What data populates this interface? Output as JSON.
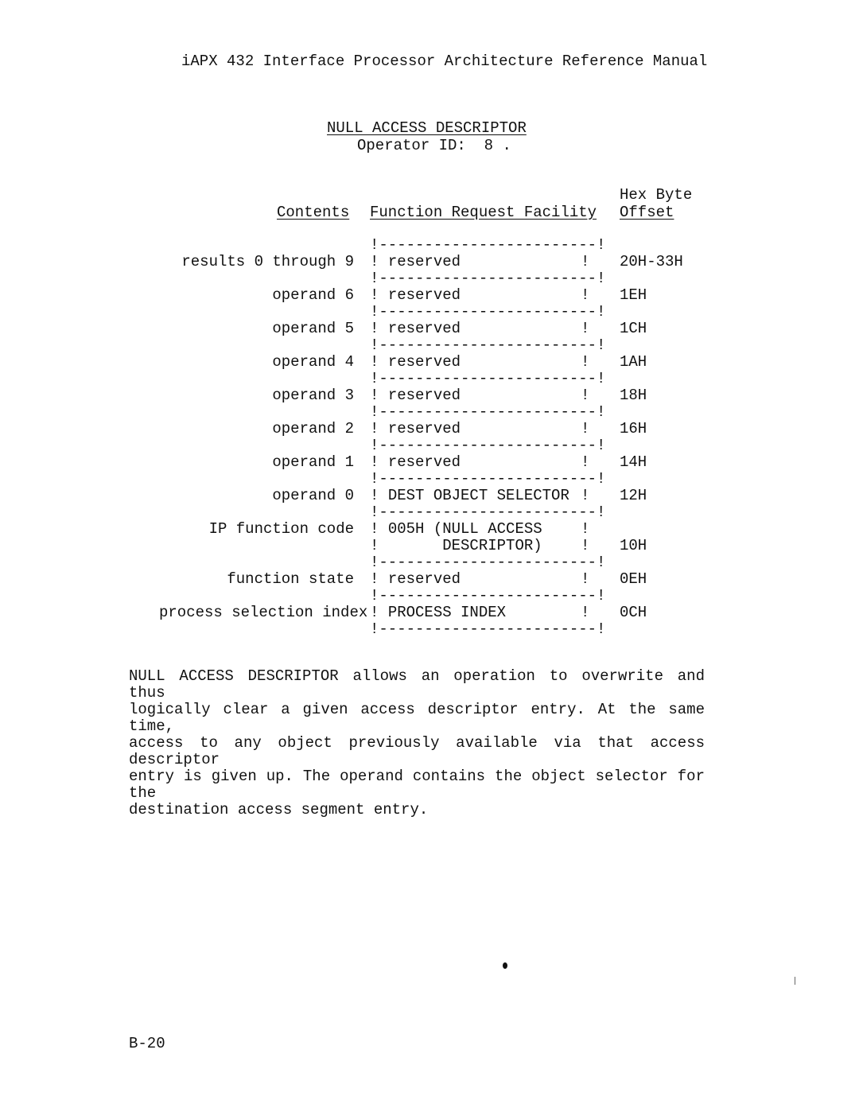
{
  "header": {
    "title": "iAPX 432 Interface Processor Architecture Reference Manual"
  },
  "section": {
    "title": "NULL ACCESS DESCRIPTOR",
    "operator_id_label": "Operator ID:",
    "operator_id_value": "8 ."
  },
  "table": {
    "headers": {
      "contents": "Contents",
      "facility": "Function Request Facility",
      "offset_line1": "Hex Byte",
      "offset_line2": "Offset"
    },
    "separator": "!------------------------!",
    "rows": [
      {
        "contents": "results 0 through 9",
        "field": "reserved",
        "offset": "20H-33H"
      },
      {
        "contents": "operand 6",
        "field": "reserved",
        "offset": "1EH"
      },
      {
        "contents": "operand 5",
        "field": "reserved",
        "offset": "1CH"
      },
      {
        "contents": "operand 4",
        "field": "reserved",
        "offset": "1AH"
      },
      {
        "contents": "operand 3",
        "field": "reserved",
        "offset": "18H"
      },
      {
        "contents": "operand 2",
        "field": "reserved",
        "offset": "16H"
      },
      {
        "contents": "operand 1",
        "field": "reserved",
        "offset": "14H"
      },
      {
        "contents": "operand 0",
        "field": "DEST OBJECT SELECTOR",
        "offset": "12H"
      },
      {
        "contents": "IP function code",
        "field": "005H (NULL ACCESS",
        "field_line2": "      DESCRIPTOR)",
        "offset": "10H"
      },
      {
        "contents": "function state",
        "field": "reserved",
        "offset": "0EH"
      },
      {
        "contents": "process selection index",
        "field": "PROCESS INDEX",
        "offset": "0CH"
      }
    ]
  },
  "description": {
    "lines": [
      "NULL ACCESS DESCRIPTOR allows an operation to overwrite and thus",
      "logically clear a given access descriptor entry.  At the same time,",
      "access to any object previously available via that access descriptor",
      "entry is given up.  The operand contains the object selector for the",
      "destination access segment entry."
    ]
  },
  "footer": {
    "page_number": "B-20"
  }
}
